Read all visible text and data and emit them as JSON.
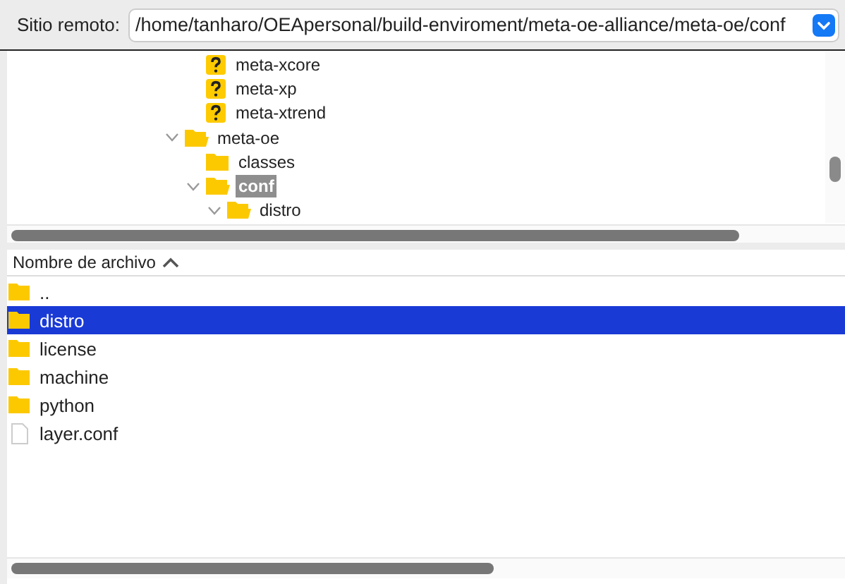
{
  "remote_site": {
    "label": "Sitio remoto:",
    "path": "/home/tanharo/OEApersonal/build-enviroment/meta-oe-alliance/meta-oe/conf"
  },
  "tree": {
    "continued_children": [
      {
        "label": "meta-xcore",
        "kind": "unknown"
      },
      {
        "label": "meta-xp",
        "kind": "unknown"
      },
      {
        "label": "meta-xtrend",
        "kind": "unknown"
      }
    ],
    "nodes": [
      {
        "label": "meta-oe",
        "kind": "folder",
        "expanded": true,
        "selected": false,
        "children": [
          {
            "label": "classes",
            "kind": "folder",
            "selected": false
          },
          {
            "label": "conf",
            "kind": "folder",
            "expanded": true,
            "selected": true,
            "children": [
              {
                "label": "distro",
                "kind": "folder",
                "expanded": true,
                "selected": false
              }
            ]
          }
        ]
      }
    ]
  },
  "file_list": {
    "columns": [
      {
        "label": "Nombre de archivo",
        "sort_ascending": true
      }
    ],
    "rows": [
      {
        "name": "..",
        "kind": "folder",
        "selected": false
      },
      {
        "name": "distro",
        "kind": "folder",
        "selected": true
      },
      {
        "name": "license",
        "kind": "folder",
        "selected": false
      },
      {
        "name": "machine",
        "kind": "folder",
        "selected": false
      },
      {
        "name": "python",
        "kind": "folder",
        "selected": false
      },
      {
        "name": "layer.conf",
        "kind": "file",
        "selected": false
      }
    ]
  }
}
